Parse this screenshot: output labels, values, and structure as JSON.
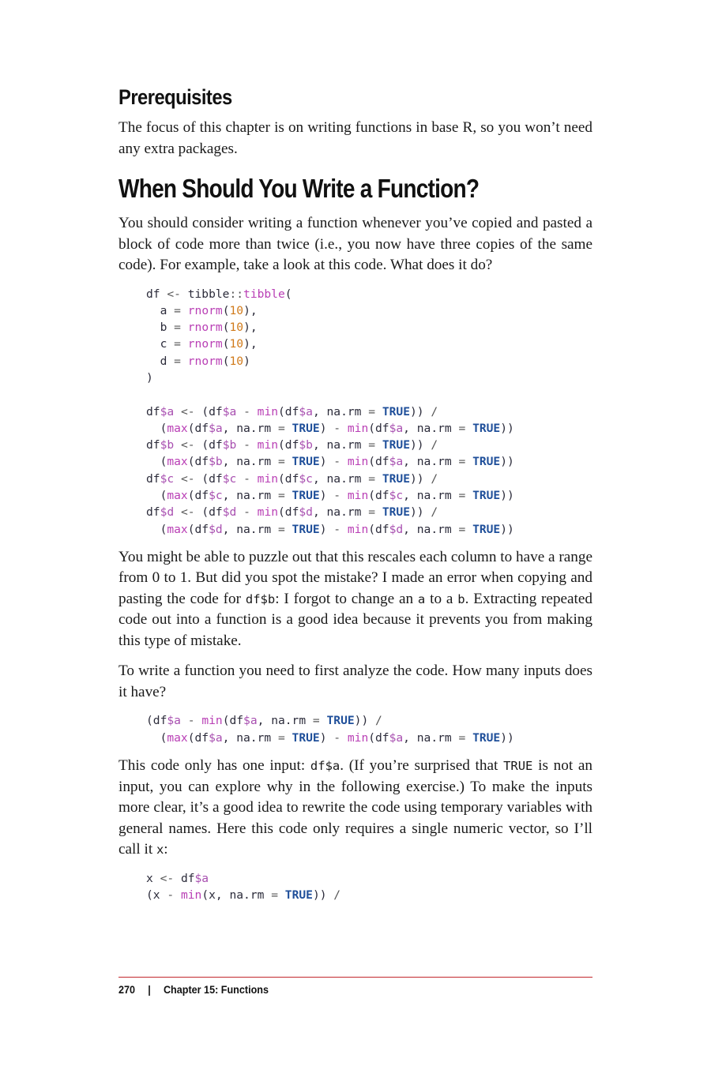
{
  "prereq": {
    "heading": "Prerequisites",
    "text": "The focus of this chapter is on writing functions in base R, so you won’t need any extra packages."
  },
  "section": {
    "heading": "When Should You Write a Function?",
    "intro": "You should consider writing a function whenever you’ve copied and pasted a block of code more than twice (i.e., you now have three copies of the same code). For example, take a look at this code. What does it do?",
    "para2_a": "You might be able to puzzle out that this rescales each column to have a range from 0 to 1. But did you spot the mistake? I made an error when copying and pasting the code for ",
    "para2_code1": "df$b",
    "para2_b": ": I forgot to change an ",
    "para2_code2": "a",
    "para2_c": " to a ",
    "para2_code3": "b",
    "para2_d": ". Extracting repeated code out into a function is a good idea because it prevents you from making this type of mistake.",
    "para3": "To write a function you need to first analyze the code. How many inputs does it have?",
    "para4_a": "This code only has one input: ",
    "para4_code1": "df$a",
    "para4_b": ". (If you’re surprised that ",
    "para4_code2": "TRUE",
    "para4_c": " is not an input, you can explore why in the following exercise.) To make the inputs more clear, it’s a good idea to rewrite the code using temporary variables with general names. Here this code only requires a single numeric vector, so I’ll call it ",
    "para4_code3": "x",
    "para4_d": ":"
  },
  "footer": {
    "page_number": "270",
    "separator": "|",
    "chapter": "Chapter 15: Functions"
  }
}
